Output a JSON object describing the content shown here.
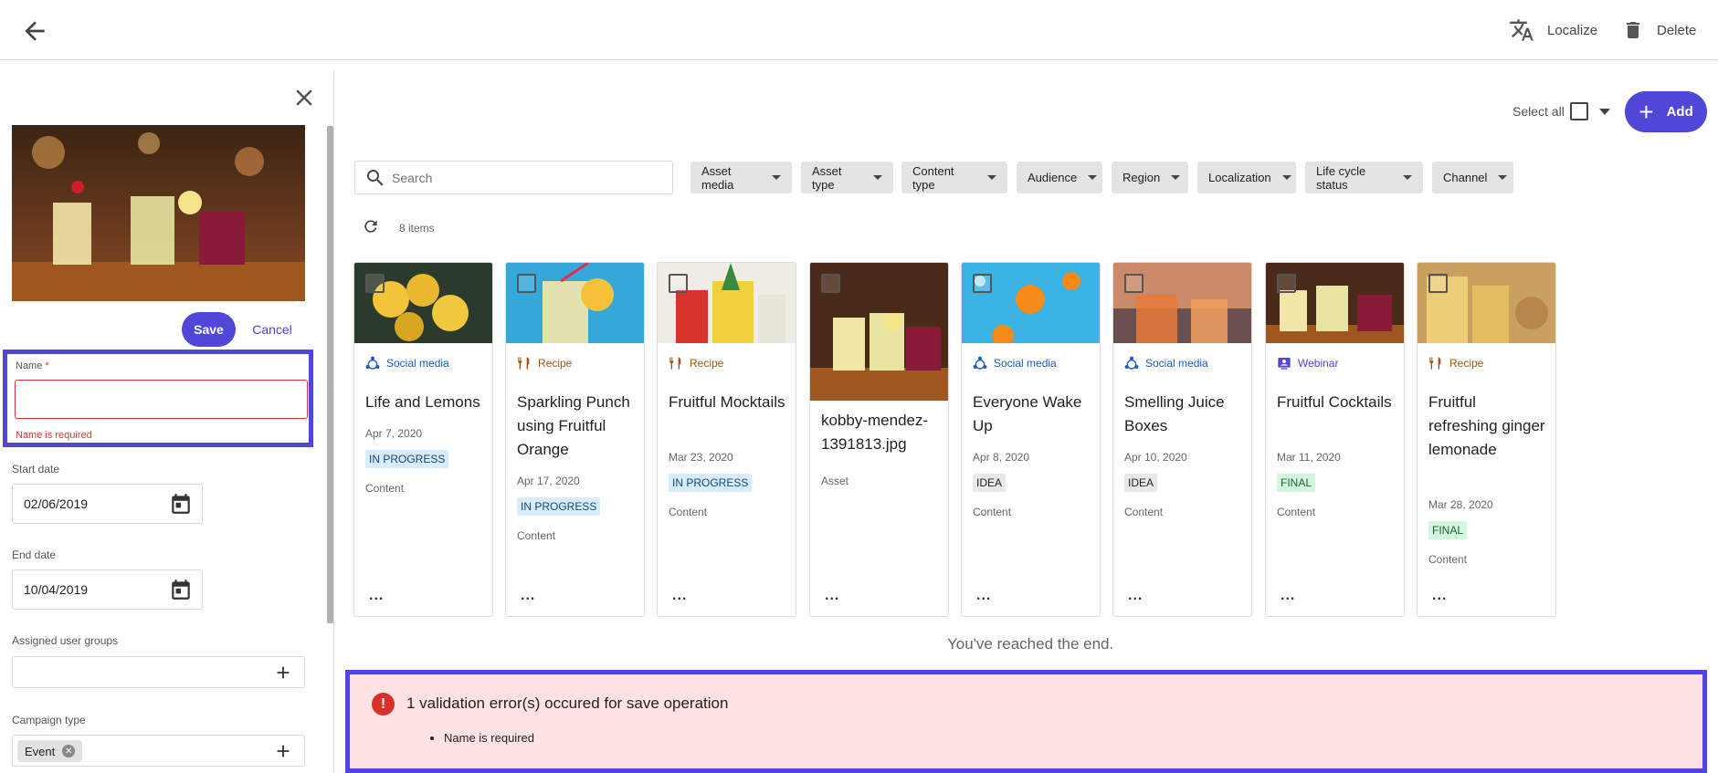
{
  "toolbar": {
    "localize_label": "Localize",
    "delete_label": "Delete"
  },
  "panel": {
    "save_label": "Save",
    "cancel_label": "Cancel",
    "name_label": "Name",
    "name_required_marker": "*",
    "name_value": "",
    "name_error": "Name is required",
    "start_date_label": "Start date",
    "start_date_value": "02/06/2019",
    "end_date_label": "End date",
    "end_date_value": "10/04/2019",
    "user_groups_label": "Assigned user groups",
    "campaign_type_label": "Campaign type",
    "campaign_type_chip": "Event"
  },
  "main": {
    "select_all_label": "Select all",
    "add_label": "Add",
    "search_placeholder": "Search",
    "item_count": "8 items",
    "filters": [
      "Asset media",
      "Asset type",
      "Content type",
      "Audience",
      "Region",
      "Localization",
      "Life cycle status",
      "Channel"
    ],
    "end_text": "You've reached the end.",
    "cards": [
      {
        "type": "Social media",
        "type_icon": "social-icon",
        "title": "Life and Lemons",
        "date": "Apr 7, 2020",
        "status": "IN PROGRESS",
        "category": "Content"
      },
      {
        "type": "Recipe",
        "type_icon": "fork-knife-icon",
        "title": "Sparkling Punch using Fruitful Orange",
        "date": "Apr 17, 2020",
        "status": "IN PROGRESS",
        "category": "Content"
      },
      {
        "type": "Recipe",
        "type_icon": "fork-knife-icon",
        "title": "Fruitful Mocktails",
        "date": "Mar 23, 2020",
        "status": "IN PROGRESS",
        "category": "Content"
      },
      {
        "type": "",
        "type_icon": "",
        "title": "kobby-mendez-1391813.jpg",
        "date": "",
        "status": "",
        "category": "Asset"
      },
      {
        "type": "Social media",
        "type_icon": "social-icon",
        "title": "Everyone Wake Up",
        "date": "Apr 8, 2020",
        "status": "IDEA",
        "category": "Content"
      },
      {
        "type": "Social media",
        "type_icon": "social-icon",
        "title": "Smelling Juice Boxes",
        "date": "Apr 10, 2020",
        "status": "IDEA",
        "category": "Content"
      },
      {
        "type": "Webinar",
        "type_icon": "webinar-icon",
        "title": "Fruitful Cocktails",
        "date": "Mar 11, 2020",
        "status": "FINAL",
        "category": "Content"
      },
      {
        "type": "Recipe",
        "type_icon": "fork-knife-icon",
        "title": "Fruitful refreshing ginger lemonade",
        "date": "Mar 28, 2020",
        "status": "FINAL",
        "category": "Content"
      }
    ],
    "more_label": "..."
  },
  "error": {
    "heading": "1 validation error(s) occured for save operation",
    "items": [
      "Name is required"
    ]
  }
}
